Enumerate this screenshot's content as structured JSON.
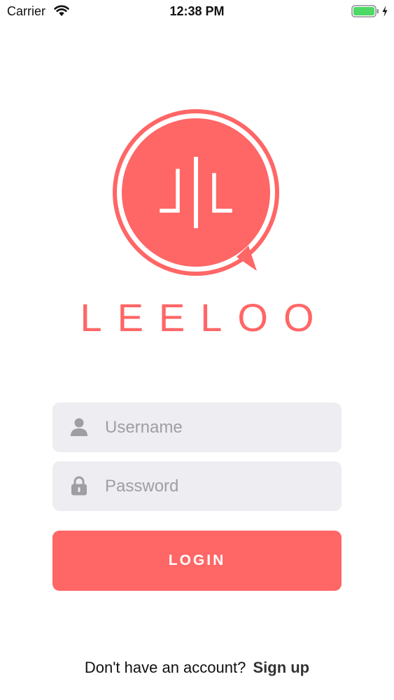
{
  "status_bar": {
    "carrier": "Carrier",
    "time": "12:38 PM",
    "wifi_icon": "wifi-icon",
    "battery_icon": "battery-icon",
    "charging_icon": "bolt-icon",
    "battery_color": "#4cd964"
  },
  "brand": {
    "name": "LEELOO",
    "logo_icon": "leeloo-logo",
    "color": "#ff6666"
  },
  "form": {
    "username": {
      "placeholder": "Username",
      "value": "",
      "icon": "user-icon"
    },
    "password": {
      "placeholder": "Password",
      "value": "",
      "icon": "lock-icon"
    },
    "login_label": "LOGIN",
    "field_background": "#eeedf1"
  },
  "footer": {
    "prompt": "Don't have an account?",
    "signup_label": "Sign up"
  }
}
